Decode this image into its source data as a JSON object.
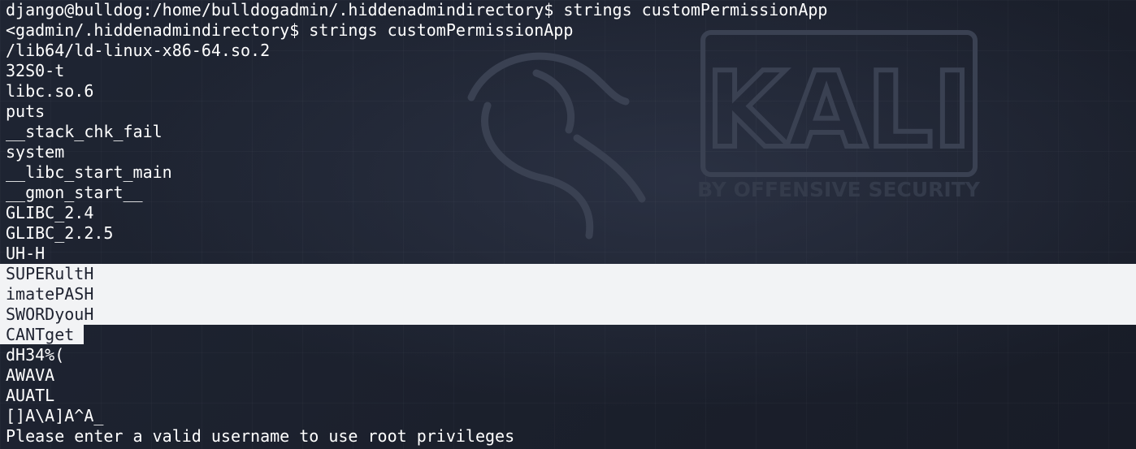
{
  "wallpaper": {
    "logo_text": "KALI",
    "tagline": "BY OFFENSIVE SECURITY"
  },
  "terminal": {
    "lines": [
      "django@bulldog:/home/bulldogadmin/.hiddenadmindirectory$ strings customPermissionApp",
      "<gadmin/.hiddenadmindirectory$ strings customPermissionApp",
      "/lib64/ld-linux-x86-64.so.2",
      "32S0-t",
      "libc.so.6",
      "puts",
      "__stack_chk_fail",
      "system",
      "__libc_start_main",
      "__gmon_start__",
      "GLIBC_2.4",
      "GLIBC_2.2.5",
      "UH-H",
      "SUPERultH",
      "imatePASH",
      "SWORDyouH",
      "CANTget",
      "dH34%(",
      "AWAVA",
      "AUATL",
      "[]A\\A]A^A_",
      "Please enter a valid username to use root privileges"
    ]
  }
}
